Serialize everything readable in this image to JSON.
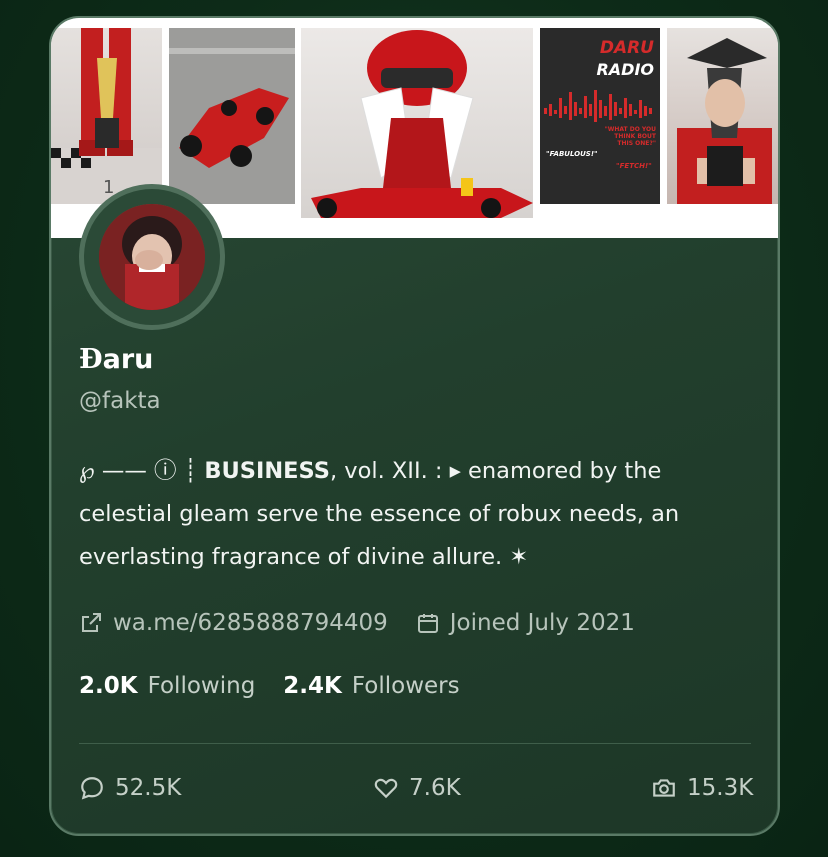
{
  "banner": {
    "radio_title": "DARU",
    "radio_subtitle": "RADIO",
    "radio_question": "\"WHAT DO YOU THINK BOUT THIS ONE?\"",
    "radio_answer1": "\"FABULOUS!\"",
    "radio_answer2": "\"FETCH!\""
  },
  "profile": {
    "name_glyph": "Ð",
    "name": "aru",
    "handle": "@fakta",
    "bio_prefix": "℘ —— ⓘ ┊ ",
    "bio_bold": "BUSINESS",
    "bio_rest": ", vol. XII. : ▸ enamored by the celestial gleam serve the essence of robux needs, an everlasting fragrance of divine allure. ✶",
    "link": "wa.me/6285888794409",
    "joined": "Joined July 2021"
  },
  "stats": {
    "following_count": "2.0K",
    "following_label": "Following",
    "followers_count": "2.4K",
    "followers_label": "Followers"
  },
  "actions": {
    "replies": "52.5K",
    "likes": "7.6K",
    "media": "15.3K"
  },
  "colors": {
    "card_bg": "#223f2d",
    "accent_red": "#d52b2b",
    "text_primary": "#ffffff",
    "text_secondary": "#b7c4bb"
  }
}
